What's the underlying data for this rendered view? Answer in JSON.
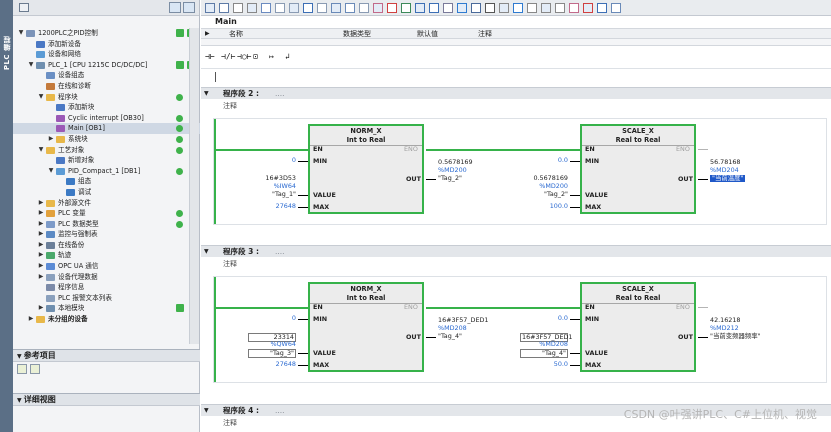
{
  "sidebar_strip": {
    "label": "PLC 编程"
  },
  "tree": {
    "items": [
      {
        "label": "1200PLC之PID控制",
        "indent": 0,
        "arrow": "▼",
        "icon": "project",
        "status": "ok-pair"
      },
      {
        "label": "添加新设备",
        "indent": 1,
        "arrow": "",
        "icon": "add-device"
      },
      {
        "label": "设备和网络",
        "indent": 1,
        "arrow": "",
        "icon": "network"
      },
      {
        "label": "PLC_1 [CPU 1215C DC/DC/DC]",
        "indent": 1,
        "arrow": "▼",
        "icon": "cpu",
        "status": "ok-pair"
      },
      {
        "label": "设备组态",
        "indent": 2,
        "arrow": "",
        "icon": "device-config"
      },
      {
        "label": "在线和诊断",
        "indent": 2,
        "arrow": "",
        "icon": "diagnostics"
      },
      {
        "label": "程序块",
        "indent": 2,
        "arrow": "▼",
        "icon": "folder",
        "status": "ok"
      },
      {
        "label": "添加新块",
        "indent": 3,
        "arrow": "",
        "icon": "add-block"
      },
      {
        "label": "Cyclic interrupt [OB30]",
        "indent": 3,
        "arrow": "",
        "icon": "ob-block",
        "status": "ok"
      },
      {
        "label": "Main [OB1]",
        "indent": 3,
        "arrow": "",
        "icon": "ob-block",
        "status": "ok",
        "selected": true
      },
      {
        "label": "系统块",
        "indent": 3,
        "arrow": "▶",
        "icon": "folder",
        "status": "ok"
      },
      {
        "label": "工艺对象",
        "indent": 2,
        "arrow": "▼",
        "icon": "folder",
        "status": "ok"
      },
      {
        "label": "新增对象",
        "indent": 3,
        "arrow": "",
        "icon": "add-object"
      },
      {
        "label": "PID_Compact_1 [DB1]",
        "indent": 3,
        "arrow": "▼",
        "icon": "pid",
        "status": "ok"
      },
      {
        "label": "组态",
        "indent": 4,
        "arrow": "",
        "icon": "config"
      },
      {
        "label": "调试",
        "indent": 4,
        "arrow": "",
        "icon": "commissioning"
      },
      {
        "label": "外部源文件",
        "indent": 2,
        "arrow": "▶",
        "icon": "folder"
      },
      {
        "label": "PLC 变量",
        "indent": 2,
        "arrow": "▶",
        "icon": "tags",
        "status": "ok"
      },
      {
        "label": "PLC 数据类型",
        "indent": 2,
        "arrow": "▶",
        "icon": "datatypes",
        "status": "ok"
      },
      {
        "label": "监控与强制表",
        "indent": 2,
        "arrow": "▶",
        "icon": "watch"
      },
      {
        "label": "在线备份",
        "indent": 2,
        "arrow": "▶",
        "icon": "backup"
      },
      {
        "label": "轨迹",
        "indent": 2,
        "arrow": "▶",
        "icon": "trace"
      },
      {
        "label": "OPC UA 通信",
        "indent": 2,
        "arrow": "▶",
        "icon": "opcua"
      },
      {
        "label": "设备代理数据",
        "indent": 2,
        "arrow": "▶",
        "icon": "proxy"
      },
      {
        "label": "程序信息",
        "indent": 2,
        "arrow": "",
        "icon": "program-info"
      },
      {
        "label": "PLC 报警文本列表",
        "indent": 2,
        "arrow": "",
        "icon": "alarm-text"
      },
      {
        "label": "本地模块",
        "indent": 2,
        "arrow": "▶",
        "icon": "local-modules",
        "status": "check"
      },
      {
        "label": "未分组的设备",
        "indent": 1,
        "arrow": "▶",
        "icon": "ungrouped"
      }
    ]
  },
  "panels": {
    "reference": "参考项目",
    "details": "详细视图"
  },
  "editor": {
    "block_title": "Main",
    "interface_columns": [
      "名称",
      "数据类型",
      "默认值",
      "注释"
    ],
    "ladder_tools": [
      "⊣⊢",
      "⊣/⊢",
      "⊣○⊢",
      "⊡",
      "↦",
      "↲"
    ]
  },
  "networks": [
    {
      "title": "程序段 2 :",
      "dots": "....",
      "comment": "注释",
      "blocks": [
        {
          "name": "NORM_X",
          "sub": "Int to Real",
          "in": [
            {
              "pin": "EN",
              "top": "",
              "bottom": "",
              "type": "en"
            },
            {
              "pin": "MIN",
              "top": "",
              "bottom": "0",
              "type": "const"
            },
            {
              "pin": "VALUE",
              "top": "16#3D53",
              "mid": "%IW64",
              "bottom": "\"Tag_1\"",
              "type": "var"
            },
            {
              "pin": "MAX",
              "top": "",
              "bottom": "27648",
              "type": "const"
            }
          ],
          "out": [
            {
              "pin": "ENO"
            },
            {
              "pin": "OUT",
              "top": "0.5678169",
              "mid": "%MD200",
              "bottom": "\"Tag_2\""
            }
          ]
        },
        {
          "name": "SCALE_X",
          "sub": "Real to Real",
          "in": [
            {
              "pin": "EN",
              "type": "en"
            },
            {
              "pin": "MIN",
              "bottom": "0.0",
              "type": "const"
            },
            {
              "pin": "VALUE",
              "top": "0.5678169",
              "mid": "%MD200",
              "bottom": "\"Tag_2\"",
              "type": "var"
            },
            {
              "pin": "MAX",
              "bottom": "100.0",
              "type": "const"
            }
          ],
          "out": [
            {
              "pin": "ENO"
            },
            {
              "pin": "OUT",
              "top": "56.78168",
              "mid": "%MD204",
              "bottom": "\"当前温度\"",
              "highlight": true
            }
          ]
        }
      ]
    },
    {
      "title": "程序段 3 :",
      "dots": "....",
      "comment": "注释",
      "blocks": [
        {
          "name": "NORM_X",
          "sub": "Int to Real",
          "in": [
            {
              "pin": "EN",
              "type": "en"
            },
            {
              "pin": "MIN",
              "bottom": "0",
              "type": "const"
            },
            {
              "pin": "VALUE",
              "top": "23314",
              "mid": "%QW64",
              "bottom": "\"Tag_3\"",
              "type": "var",
              "boxed": true
            },
            {
              "pin": "MAX",
              "bottom": "27648",
              "type": "const"
            }
          ],
          "out": [
            {
              "pin": "ENO"
            },
            {
              "pin": "OUT",
              "top": "16#3F57_DED1",
              "mid": "%MD208",
              "bottom": "\"Tag_4\""
            }
          ]
        },
        {
          "name": "SCALE_X",
          "sub": "Real to Real",
          "in": [
            {
              "pin": "EN",
              "type": "en"
            },
            {
              "pin": "MIN",
              "bottom": "0.0",
              "type": "const"
            },
            {
              "pin": "VALUE",
              "top": "16#3F57_DED1",
              "mid": "%MD208",
              "bottom": "\"Tag_4\"",
              "type": "var",
              "boxed": true
            },
            {
              "pin": "MAX",
              "bottom": "50.0",
              "type": "const"
            }
          ],
          "out": [
            {
              "pin": "ENO"
            },
            {
              "pin": "OUT",
              "top": "42.16218",
              "mid": "%MD212",
              "bottom": "\"当前变频器频率\""
            }
          ]
        }
      ]
    },
    {
      "title": "程序段 4 :",
      "dots": "....",
      "comment": "注释",
      "blocks": []
    }
  ],
  "watermark": "CSDN @叶强讲PLC、C#上位机、视觉",
  "colors": {
    "rung": "#36b24a",
    "selection": "#1f58c8",
    "address": "#2868d0"
  }
}
